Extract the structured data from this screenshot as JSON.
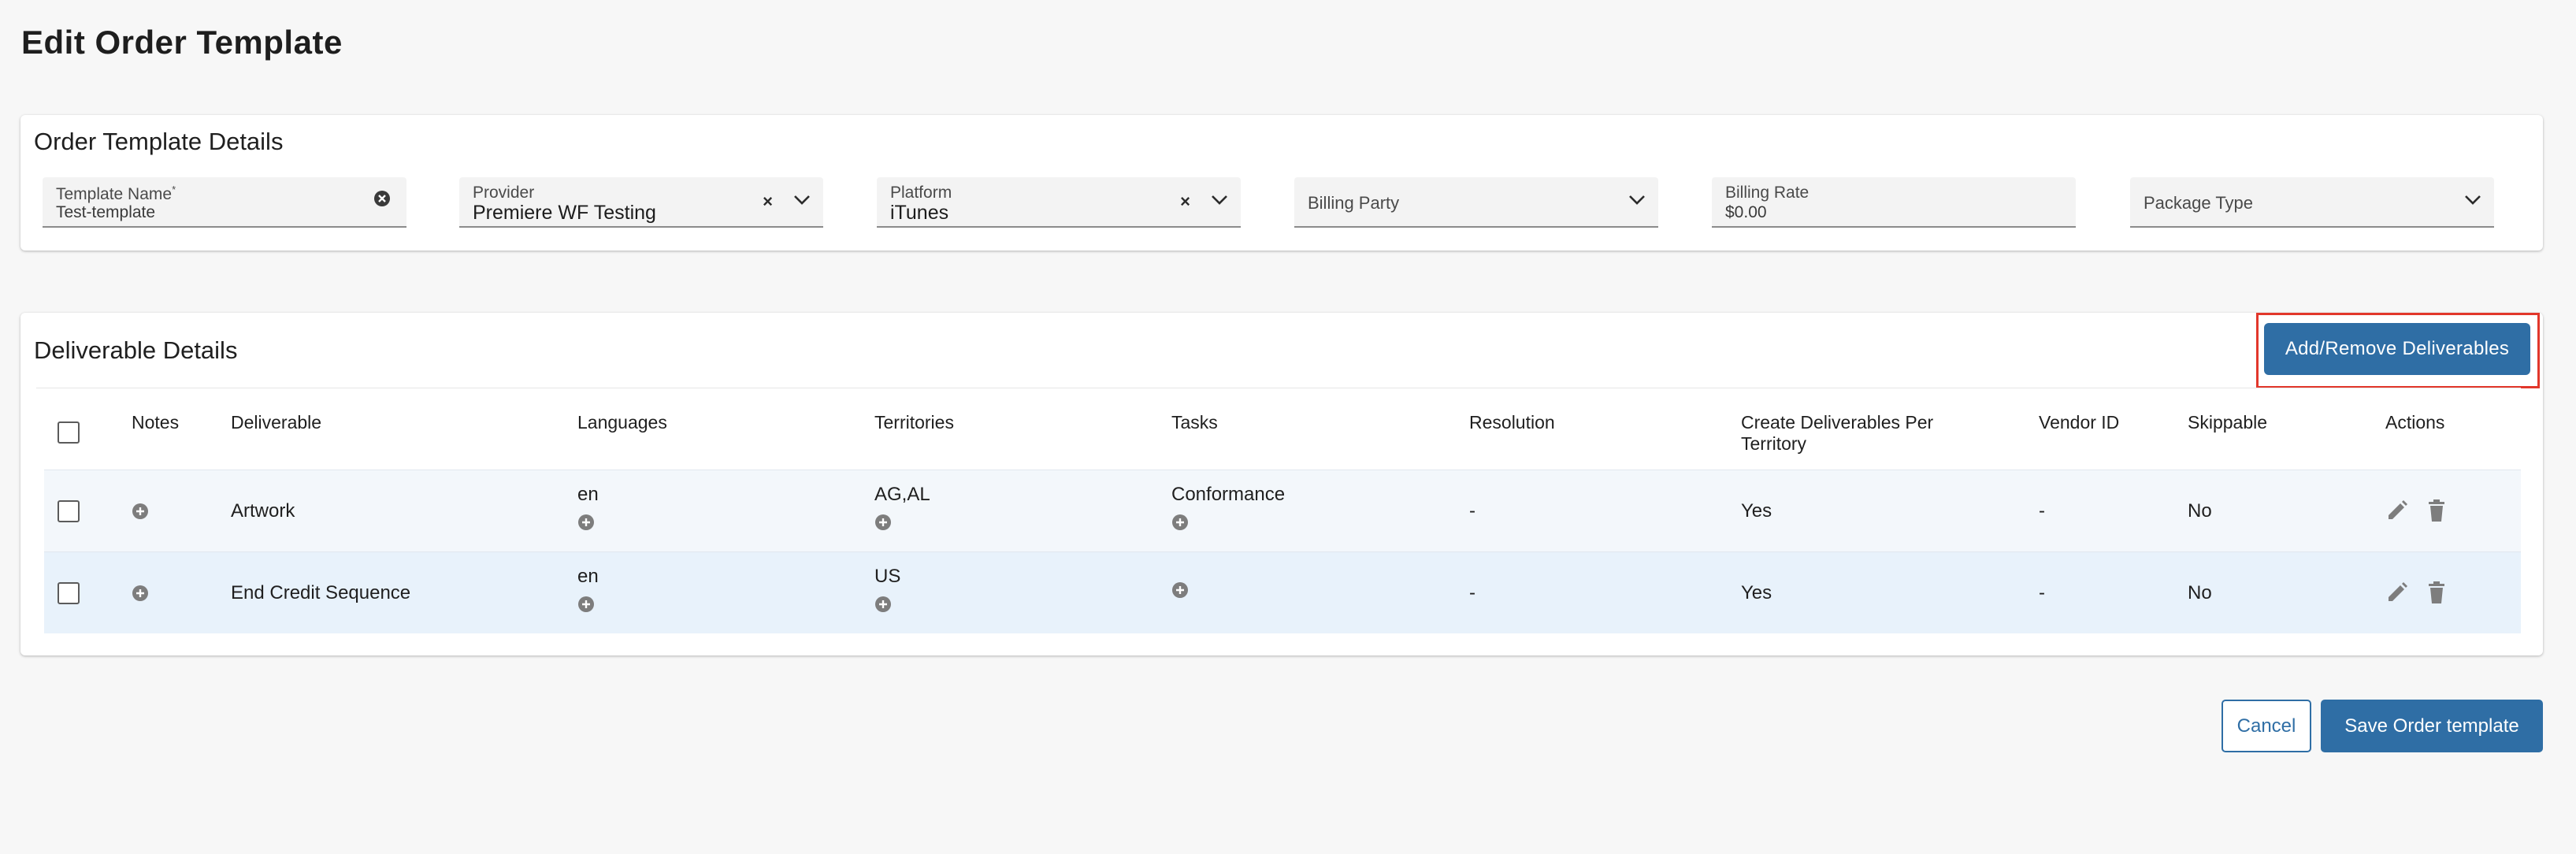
{
  "page": {
    "title": "Edit Order Template"
  },
  "details": {
    "title": "Order Template Details",
    "fields": [
      {
        "label": "Template Name",
        "required_mark": "*",
        "value": "Test-template"
      },
      {
        "label": "Provider",
        "value": "Premiere WF Testing"
      },
      {
        "label": "Platform",
        "value": "iTunes"
      },
      {
        "label": "Billing Party",
        "value": ""
      },
      {
        "label": "Billing Rate",
        "value": "$0.00"
      },
      {
        "label": "Package Type",
        "value": ""
      }
    ]
  },
  "deliverables": {
    "title": "Deliverable Details",
    "add_remove_label": "Add/Remove Deliverables",
    "columns": {
      "notes": "Notes",
      "deliverable": "Deliverable",
      "languages": "Languages",
      "territories": "Territories",
      "tasks": "Tasks",
      "resolution": "Resolution",
      "create_per_territory_line1": "Create Deliverables Per",
      "create_per_territory_line2": "Territory",
      "vendor_id": "Vendor ID",
      "skippable": "Skippable",
      "actions": "Actions"
    },
    "rows": [
      {
        "deliverable": "Artwork",
        "languages": "en",
        "territories": "AG,AL",
        "tasks": "Conformance",
        "resolution": "-",
        "create_per_territory": "Yes",
        "vendor_id": "-",
        "skippable": "No"
      },
      {
        "deliverable": "End Credit Sequence",
        "languages": "en",
        "territories": "US",
        "tasks": "",
        "resolution": "-",
        "create_per_territory": "Yes",
        "vendor_id": "-",
        "skippable": "No"
      }
    ]
  },
  "footer": {
    "cancel_label": "Cancel",
    "save_label": "Save Order template"
  },
  "colors": {
    "primary": "#2f6ea5",
    "highlight": "#e2372b",
    "row_alt": "#e8f2fb"
  }
}
